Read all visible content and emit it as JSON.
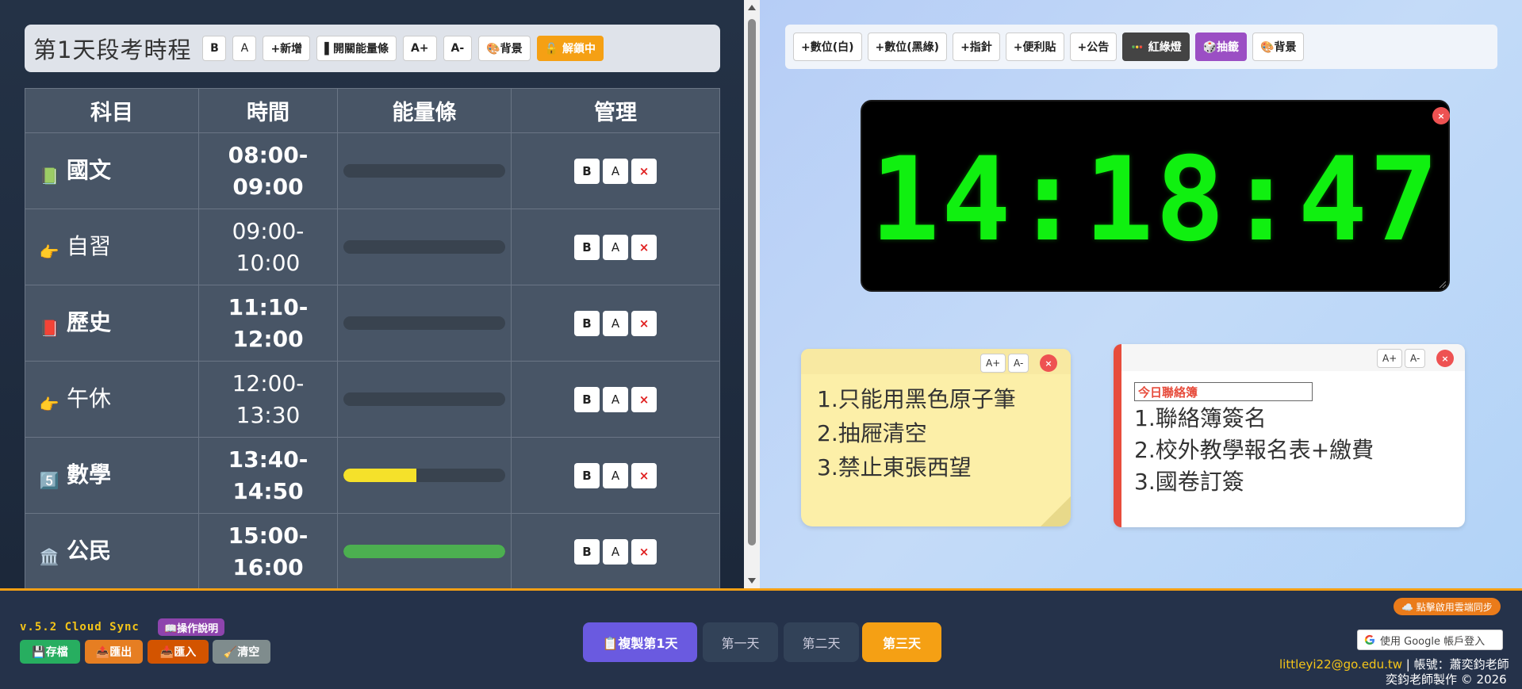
{
  "left_panel": {
    "title": "第1天段考時程",
    "toolbar": {
      "bold": "B",
      "font": "A",
      "add": "+新增",
      "energy_toggle": "▌開關能量條",
      "font_up": "A+",
      "font_down": "A-",
      "background": "🎨背景",
      "lock": "🔓 解鎖中"
    },
    "table": {
      "headers": [
        "科目",
        "時間",
        "能量條",
        "管理"
      ],
      "rows": [
        {
          "emoji": "📗",
          "subject": "國文",
          "time_start": "08:00-",
          "time_end": "09:00",
          "bold": true,
          "energy": 0,
          "energy_color": "#39434f"
        },
        {
          "emoji": "👉",
          "subject": "自習",
          "time_start": "09:00-",
          "time_end": "10:00",
          "bold": false,
          "energy": 0,
          "energy_color": "#39434f"
        },
        {
          "emoji": "📕",
          "subject": "歷史",
          "time_start": "11:10-",
          "time_end": "12:00",
          "bold": true,
          "energy": 0,
          "energy_color": "#39434f"
        },
        {
          "emoji": "👉",
          "subject": "午休",
          "time_start": "12:00-",
          "time_end": "13:30",
          "bold": false,
          "energy": 0,
          "energy_color": "#39434f"
        },
        {
          "emoji": "5️⃣",
          "subject": "數學",
          "time_start": "13:40-",
          "time_end": "14:50",
          "bold": true,
          "energy": 0.45,
          "energy_color": "#f5e12a"
        },
        {
          "emoji": "🏛️",
          "subject": "公民",
          "time_start": "15:00-",
          "time_end": "16:00",
          "bold": true,
          "energy": 1.0,
          "energy_color": "#4caf50"
        }
      ],
      "mgmt": {
        "bold": "B",
        "font": "A",
        "delete": "×"
      }
    }
  },
  "right_panel": {
    "toolbar": {
      "digital_white": "+數位(白)",
      "digital_black_green": "+數位(黑綠)",
      "analog": "+指針",
      "sticky": "+便利貼",
      "notice": "+公告",
      "traffic_light": "🚥 紅綠燈",
      "lottery": "🎲抽籤",
      "background": "🎨背景"
    },
    "clock": {
      "time": "14:18:47",
      "close": "×"
    },
    "sticky_note": {
      "font_up": "A+",
      "font_down": "A-",
      "close": "×",
      "lines": [
        "1.只能用黑色原子筆",
        "2.抽屜清空",
        "3.禁止東張西望"
      ]
    },
    "notice_note": {
      "font_up": "A+",
      "font_down": "A-",
      "close": "×",
      "label": "今日聯絡簿",
      "lines": [
        "1.聯絡簿簽名",
        "2.校外教學報名表+繳費",
        "3.國卷訂簽"
      ]
    }
  },
  "bottom_bar": {
    "version": "v.5.2 Cloud Sync",
    "help": "📖操作說明",
    "save": "💾存檔",
    "export": "📤匯出",
    "import": "📥匯入",
    "clear": "🧹清空",
    "copy_day1": "📋複製第1天",
    "day1": "第一天",
    "day2": "第二天",
    "day3": "第三天",
    "cloud_sync": "☁️ 點擊啟用雲端同步",
    "google_login": "使用 Google 帳戶登入",
    "account_email": "littleyi22@go.edu.tw",
    "account_suffix": " | 帳號：蕭奕鈞老師",
    "copyright": "奕鈞老師製作 © 2026"
  },
  "colors": {
    "accent_orange": "#f5a014",
    "clock_green": "#10f010",
    "purple": "#6a5ae0",
    "note_red": "#e74c3c"
  }
}
